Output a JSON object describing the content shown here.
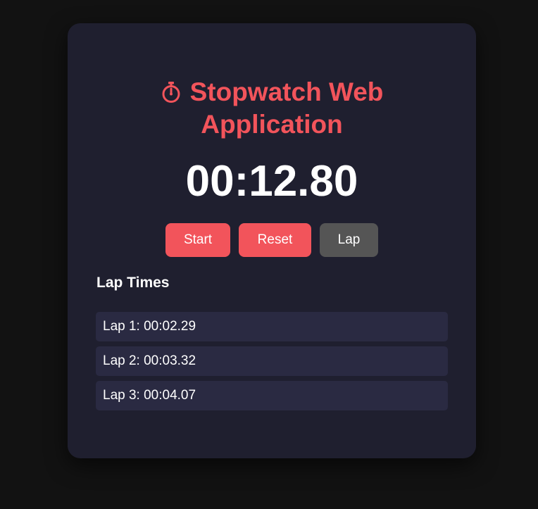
{
  "app": {
    "title_line1": "Stopwatch Web",
    "title_line2": "Application",
    "title_icon": "stopwatch-icon",
    "accent_color": "#f2545b"
  },
  "display": {
    "time": "00:12.80"
  },
  "controls": {
    "start_label": "Start",
    "reset_label": "Reset",
    "lap_label": "Lap"
  },
  "laps": {
    "heading": "Lap Times",
    "items": [
      {
        "label": "Lap 1: 00:02.29"
      },
      {
        "label": "Lap 2: 00:03.32"
      },
      {
        "label": "Lap 3: 00:04.07"
      }
    ]
  }
}
